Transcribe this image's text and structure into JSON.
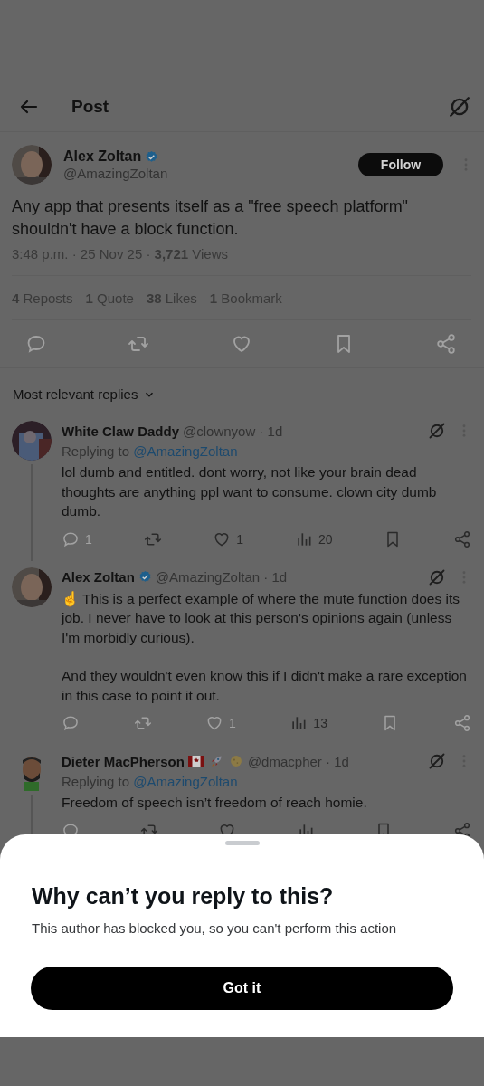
{
  "header": {
    "title": "Post"
  },
  "post": {
    "author": {
      "name": "Alex Zoltan",
      "handle": "@AmazingZoltan",
      "verified": true
    },
    "follow_button": "Follow",
    "text": "Any app that presents itself as a \"free speech platform\" shouldn't have a block function.",
    "meta": "3:48 p.m. · 25 Nov 25 · **3,721** Views",
    "stats": [
      "**4** Reposts",
      "**1** Quote",
      "**38** Likes",
      "**1** Bookmark"
    ],
    "actions": [
      {
        "kind": "reply",
        "disabled": true
      },
      {
        "kind": "repost",
        "disabled": true
      },
      {
        "kind": "like",
        "disabled": true
      },
      {
        "kind": "bookmark",
        "disabled": true
      },
      {
        "kind": "share",
        "disabled": true
      }
    ]
  },
  "replies_sort": {
    "label": "Most relevant replies"
  },
  "replies": [
    {
      "name": "White Claw Daddy",
      "verified": false,
      "handle": "@clownyow · 1d",
      "replying_label": "Replying to",
      "replying_to": "@AmazingZoltan",
      "paragraphs": [
        "lol dumb and entitled. dont worry, not like your brain dead thoughts are anything ppl want to consume. clown city dumb dumb."
      ],
      "thread_line": true,
      "actions": [
        {
          "kind": "reply",
          "count": "1",
          "disabled": true
        },
        {
          "kind": "repost",
          "disabled": false
        },
        {
          "kind": "like",
          "count": "1",
          "disabled": false
        },
        {
          "kind": "views",
          "count": "20",
          "disabled": false
        },
        {
          "kind": "bookmark",
          "disabled": false
        },
        {
          "kind": "share",
          "disabled": false
        }
      ]
    },
    {
      "name": "Alex Zoltan",
      "verified": true,
      "handle": "@AmazingZoltan · 1d",
      "paragraphs": [
        "☝ This is a perfect example of where the mute function does its job. I never have to look at this person's opinions again (unless I'm morbidly curious).",
        "And they wouldn't even know this if I didn't make a rare exception in this case to point it out."
      ],
      "thread_line": false,
      "actions": [
        {
          "kind": "reply",
          "disabled": true
        },
        {
          "kind": "repost",
          "disabled": true
        },
        {
          "kind": "like",
          "count": "1",
          "disabled": true
        },
        {
          "kind": "views",
          "count": "13",
          "disabled": false
        },
        {
          "kind": "bookmark",
          "disabled": true
        },
        {
          "kind": "share",
          "disabled": true
        }
      ]
    },
    {
      "name": "Dieter MacPherson",
      "verified": false,
      "badges": [
        {
          "kind": "flag"
        },
        {
          "kind": "rocket"
        },
        {
          "kind": "moon"
        }
      ],
      "handle": "@dmacpher · 1d",
      "replying_label": "Replying to",
      "replying_to": "@AmazingZoltan",
      "paragraphs": [
        "Freedom of speech isn’t freedom of reach homie."
      ],
      "thread_line": true,
      "actions": [
        {
          "kind": "reply",
          "disabled": true
        },
        {
          "kind": "repost",
          "disabled": false
        },
        {
          "kind": "like",
          "disabled": false
        },
        {
          "kind": "views",
          "disabled": false
        },
        {
          "kind": "bookmark",
          "disabled": false
        },
        {
          "kind": "share",
          "disabled": false
        }
      ]
    }
  ],
  "sheet": {
    "title": "Why can’t you reply to this?",
    "message": "This author has blocked you, so you can't perform this action",
    "button": "Got it"
  }
}
